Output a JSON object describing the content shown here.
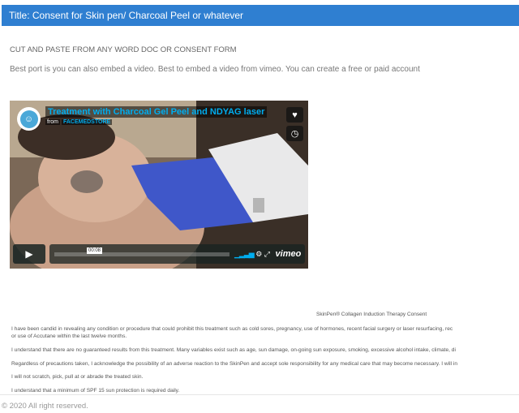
{
  "page": {
    "title": "Title: Consent for Skin pen/ Charcoal Peel or whatever",
    "line1": "CUT AND PASTE FROM ANY WORD DOC OR CONSENT FORM",
    "line2": "Best port is you can also embed a video.  Best to embed a video from vimeo.  You can create a free or paid account"
  },
  "video": {
    "title": "Treatment with Charcoal Gel Peel and NDYAG laser",
    "from_label": "from",
    "channel": "FACEMEDSTORE",
    "time": "00:08",
    "brand": "vimeo",
    "progress": 0.0
  },
  "consent": {
    "title": "SkinPen® Collagen Induction Therapy Consent",
    "paragraphs": [
      "I have been candid in revealing any condition or procedure that could prohibit this treatment such as cold sores, pregnancy, use of hormones, recent facial surgery or laser resurfacing, rec",
      "or use of Accutane within the last twelve months.",
      "I understand that there are no guaranteed results from this treatment. Many variables exist such as age, sun damage, on-going sun exposure, smoking, excessive alcohol intake, climate, di",
      "Regardless of precautions taken, I acknowledge the possibility of an adverse reaction to the SkinPen and accept sole responsibility for any medical care that may become necessary. I will in",
      "I will not scratch, pick, pull at or abrade the treated skin.",
      "I understand that a minimum of SPF 15 sun protection is required daily."
    ]
  },
  "footer": {
    "copyright": "© 2020 All right reserved."
  },
  "colors": {
    "title_bar": "#2f7fd1",
    "vimeo_blue": "#00adef"
  }
}
